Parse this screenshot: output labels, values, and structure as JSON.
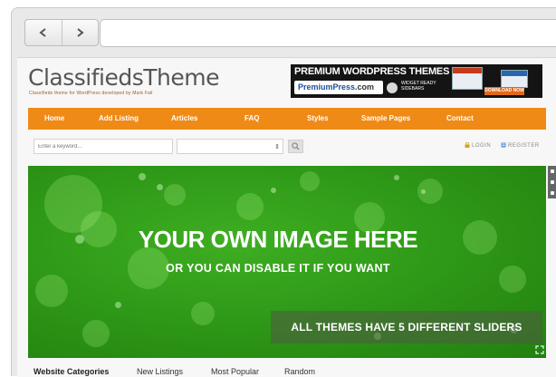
{
  "site": {
    "logo": "ClassifiedsTheme",
    "tagline": "Classifieds theme for WordPress developed by Mark Fail"
  },
  "banner": {
    "title": "PREMIUM WORDPRESS THEMES",
    "brand": "PremiumPress",
    "brand_suffix": ".com",
    "sub": "WIDGET READY SIDEBARS",
    "cta": "DOWNLOAD NOW"
  },
  "menu": {
    "items": [
      "Home",
      "Add Listing",
      "Articles",
      "FAQ",
      "Styles",
      "Sample Pages",
      "Contact"
    ]
  },
  "search": {
    "placeholder": "Enter a keyword...",
    "login": "LOGIN",
    "register": "REGISTER"
  },
  "hero": {
    "title": "YOUR OWN IMAGE HERE",
    "subtitle": "OR YOU CAN DISABLE IT IF YOU WANT",
    "caption": "ALL THEMES HAVE 5 DIFFERENT SLIDERS"
  },
  "tabs": {
    "items": [
      "Website Categories",
      "New Listings",
      "Most Popular",
      "Random"
    ],
    "active": "Website Categories"
  },
  "colors": {
    "menu": "#f08a16",
    "hero": "#2f9a18",
    "banner": "#141414"
  },
  "icons": {
    "back": "chevron-left-icon",
    "forward": "chevron-right-icon",
    "search": "search-icon",
    "login": "lock-icon",
    "register": "register-icon",
    "fullscreen": "fullscreen-icon"
  }
}
